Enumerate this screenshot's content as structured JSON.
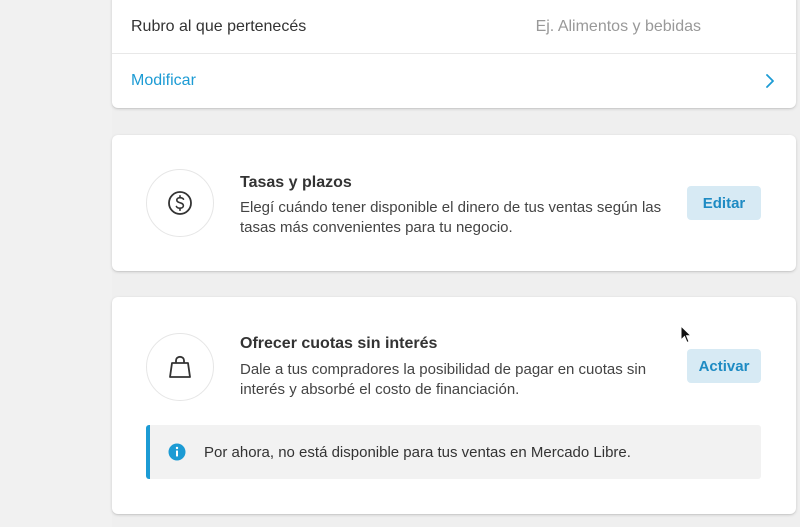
{
  "profile_card": {
    "rubro_label": "Rubro al que pertenecés",
    "rubro_placeholder": "Ej. Alimentos y bebidas",
    "modify_link": "Modificar"
  },
  "rates_card": {
    "title": "Tasas y plazos",
    "description": "Elegí cuándo tener disponible el dinero de tus ventas según las tasas más convenientes para tu negocio.",
    "button_label": "Editar",
    "icon": "dollar-coin-icon"
  },
  "installments_card": {
    "title": "Ofrecer cuotas sin interés",
    "description": "Dale a tus compradores la posibilidad de pagar en cuotas sin interés y absorbé el costo de financiación.",
    "button_label": "Activar",
    "icon": "shopping-bag-icon",
    "notice_text": "Por ahora, no está disponible para tus ventas en Mercado Libre."
  },
  "colors": {
    "accent": "#1c9bd4",
    "button_bg": "#d7eaf4",
    "button_text": "#1e8bc3"
  }
}
